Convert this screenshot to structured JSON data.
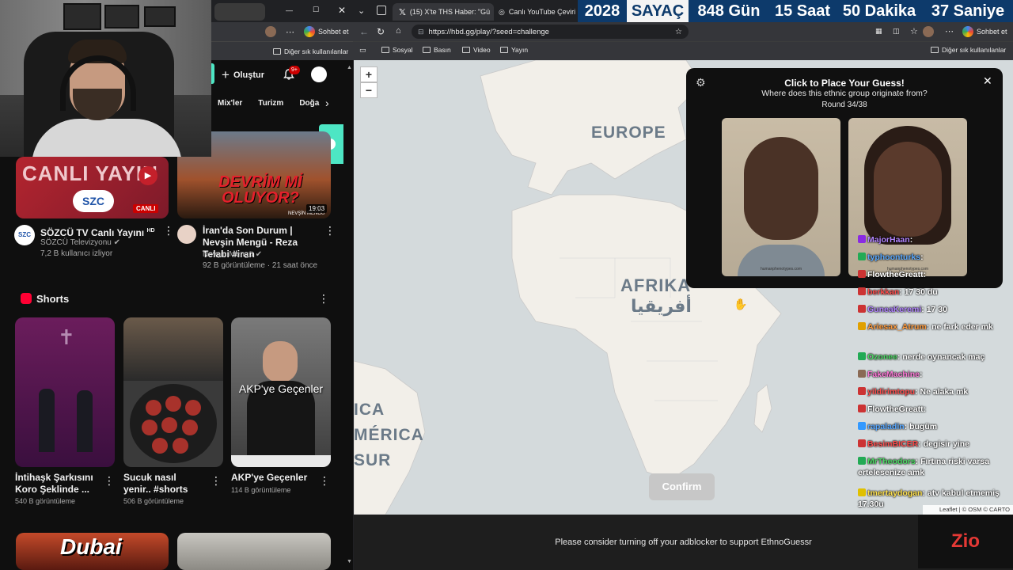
{
  "youtube": {
    "create_label": "Oluştur",
    "notif_badge": "9+",
    "chips": [
      "Mix'ler",
      "Turizm",
      "Doğa"
    ],
    "bookmarks_other": "Diğer sık kullanılanlar",
    "chat_label": "Sohbet et",
    "videos": [
      {
        "thumb_text": "CANLI YAYIN",
        "thumb_logo": "SZC",
        "thumb_badge": "CANLI",
        "title": "SÖZCÜ TV Canlı Yayını",
        "hd": "HD",
        "channel": "SÖZCÜ Televizyonu",
        "meta": "7,2 B kullanıcı izliyor",
        "avatar": "SZC"
      },
      {
        "thumb_text": "DEVRİM Mİ OLUYOR?",
        "thumb_sub": "NEVŞİN MENGÜ",
        "duration": "19:03",
        "title": "İran'da Son Durum | Nevşin Mengü - Reza Telabi #iran",
        "channel": "Nevşin Mengü",
        "meta": "92 B görüntüleme · 21 saat önce"
      }
    ],
    "shorts_title": "Shorts",
    "shorts": [
      {
        "title": "İntihaşk Şarkısını Koro Şeklinde ...",
        "meta": "540 B görüntüleme"
      },
      {
        "title": "Sucuk nasıl yenir.. #shorts",
        "meta": "506 B görüntüleme"
      },
      {
        "title": "AKP'ye Geçenler",
        "meta": "114 B görüntüleme",
        "overlay": "AKP'ye Geçenler"
      }
    ],
    "bottom_thumb_text": "Dubai"
  },
  "browser": {
    "tabs": [
      {
        "label": "(15) X'te THS Haber: \"Gü"
      },
      {
        "label": "Canlı YouTube Çeviri - A"
      }
    ],
    "url": "https://hbd.gg/play/?seed=challenge",
    "bookmarks": [
      "Sosyal",
      "Basın",
      "Video",
      "Yayın"
    ],
    "bookmarks_other": "Diğer sık kullanılanlar",
    "chat_label": "Sohbet et"
  },
  "counter": {
    "year": "2028",
    "label": "SAYAÇ",
    "days": "848 Gün",
    "hours": "15 Saat",
    "minutes": "50 Dakika",
    "seconds": "37 Saniye"
  },
  "map": {
    "zoom_in": "+",
    "zoom_out": "−",
    "labels": {
      "europe": "EUROPE",
      "africa": "AFRIKA",
      "africa_ar": "أفريقيا",
      "america1": "ICA",
      "america2": "MÉRICA",
      "america3": "SUR"
    },
    "attribution": "Leaflet | © OSM © CARTO"
  },
  "guess": {
    "title": "Click to Place Your Guess!",
    "question": "Where does this ethnic group originate from?",
    "round": "Round 34/38",
    "face_caption_1": "humanphenotypes.com",
    "face_caption_2": "humanphenotypes.com"
  },
  "chat": [
    {
      "user": "MajorHaan",
      "text": "",
      "color": "#b284ff"
    },
    {
      "user": "typhoonturks",
      "text": "",
      "color": "#5aa9ff"
    },
    {
      "user": "FlowtheGreatt",
      "text": "",
      "color": "#ffffff"
    },
    {
      "user": "berkkan",
      "text": "17 30 du",
      "color": "#ff4d4d"
    },
    {
      "user": "GuneaKeremi",
      "text": "17 30",
      "color": "#b284ff"
    },
    {
      "user": "Ariesax_Atrum",
      "text": "ne fark eder mk",
      "color": "#ff9b3d"
    },
    {
      "user": "Ozonee",
      "text": "nerde oynancak maç",
      "color": "#4cd964"
    },
    {
      "user": "FakeMachine",
      "text": "",
      "color": "#ff7ad9"
    },
    {
      "user": "yildirimtopu",
      "text": "Ne alaka mk",
      "color": "#ff4d4d"
    },
    {
      "user": "FlowtheGreatt",
      "text": "",
      "color": "#ffffff"
    },
    {
      "user": "rapaladin",
      "text": "bugüm",
      "color": "#5aa9ff"
    },
    {
      "user": "BesimBICER",
      "text": "degisir yine",
      "color": "#ff4d4d"
    },
    {
      "user": "MrTheodors",
      "text": "Fırtına riski varsa ertelesenize amk",
      "color": "#4cd964"
    },
    {
      "user": "tmertaydogan",
      "text": "atv kabul etmemiş 17.30u",
      "color": "#ffe14d"
    }
  ],
  "confirm_label": "Confirm",
  "ad_notice": "Please consider turning off your adblocker to support EthnoGuessr",
  "stream_logo": "Zio",
  "colors": {
    "map_water": "#d4dadc",
    "map_land": "#f2efe9",
    "counter_bg": "#0d3a6b",
    "youtube_bg": "#0f0f0f",
    "accent_teal": "#4de6c4"
  }
}
